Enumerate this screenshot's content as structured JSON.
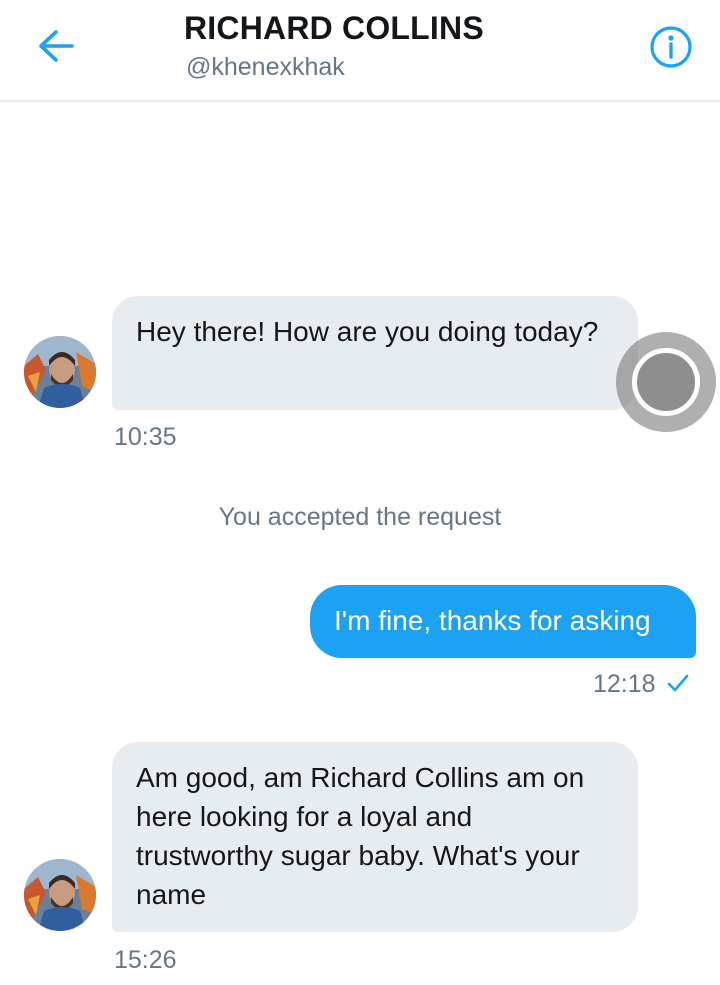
{
  "header": {
    "title": "RICHARD COLLINS",
    "handle": "@khenexkhak",
    "back_icon": "arrow-left-icon",
    "info_icon": "info-icon",
    "accent_color": "#1da1f2"
  },
  "messages": [
    {
      "direction": "received",
      "text": "Hey there! How are you doing today?",
      "time": "10:35"
    },
    {
      "direction": "system",
      "text": "You accepted the request"
    },
    {
      "direction": "sent",
      "text": "I'm fine, thanks for asking",
      "time": "12:18",
      "status_icon": "checkmark-icon"
    },
    {
      "direction": "received",
      "text": "Am good, am Richard Collins am on here looking for a loyal and trustworthy sugar baby. What's your name",
      "time": "15:26"
    }
  ],
  "colors": {
    "received_bubble": "#e6ecf0",
    "sent_bubble": "#1da1f2",
    "secondary_text": "#657786"
  }
}
